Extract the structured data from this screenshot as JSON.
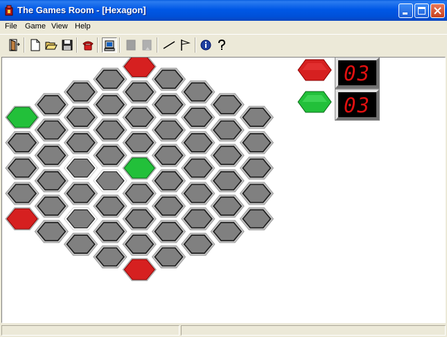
{
  "window": {
    "title": "The Games Room - [Hexagon]"
  },
  "menu": {
    "items": [
      "File",
      "Game",
      "View",
      "Help"
    ]
  },
  "toolbar": {
    "buttons": [
      {
        "name": "exit-button",
        "icon": "door-exit-icon"
      },
      {
        "name": "new-button",
        "icon": "new-document-icon"
      },
      {
        "name": "open-button",
        "icon": "open-folder-icon"
      },
      {
        "name": "save-button",
        "icon": "floppy-disk-icon"
      },
      {
        "name": "phone-button",
        "icon": "telephone-icon"
      },
      {
        "name": "computer-button",
        "icon": "computer-icon"
      },
      {
        "name": "undo-button",
        "icon": "disabled-square-icon"
      },
      {
        "name": "redo-button",
        "icon": "disabled-square-icon"
      },
      {
        "name": "line-button",
        "icon": "line-icon"
      },
      {
        "name": "flag-button",
        "icon": "flag-icon"
      },
      {
        "name": "info-button",
        "icon": "info-icon"
      },
      {
        "name": "help-button",
        "icon": "question-mark-icon"
      }
    ]
  },
  "game": {
    "name": "Hexagon",
    "colors": {
      "red": "#d62020",
      "green": "#22c03a",
      "empty": "#808080"
    },
    "score": {
      "red": "03",
      "green": "03"
    },
    "pieces": {
      "red": [
        [
          0,
          4
        ],
        [
          4,
          0
        ],
        [
          4,
          8
        ]
      ],
      "green": [
        [
          0,
          0
        ],
        [
          0,
          8
        ],
        [
          4,
          4
        ]
      ]
    },
    "holes": [
      [
        3,
        4
      ],
      [
        2,
        3
      ],
      [
        2,
        5
      ]
    ]
  },
  "statusbar": {
    "text": ""
  }
}
